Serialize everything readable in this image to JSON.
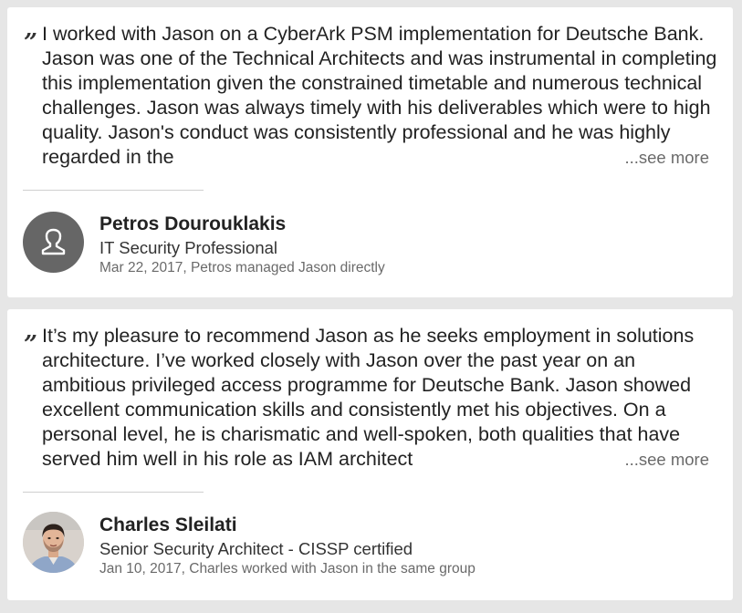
{
  "recommendations": [
    {
      "quote": "I worked with Jason on a CyberArk PSM implementation for Deutsche Bank. Jason was one of the Technical Architects and was instrumental in completing this implementation given the constrained timetable and numerous technical challenges. Jason was always timely with his deliverables which were to high quality. Jason's conduct was consistently professional and he was highly regarded in the",
      "see_more": "...see more",
      "name": "Petros Dourouklakis",
      "title": "IT Security Professional",
      "meta": "Mar 22, 2017, Petros managed Jason directly",
      "avatar_icon": "default-person-icon"
    },
    {
      "quote": "It’s my pleasure to recommend Jason as he seeks employment in solutions architecture. I’ve worked closely with Jason over the past year on an ambitious privileged access programme for Deutsche Bank. Jason showed excellent communication skills and consistently met his objectives. On a personal level, he is charismatic and well-spoken, both qualities that have served him well in his role as IAM architect",
      "see_more": "...see more",
      "name": "Charles Sleilati",
      "title": "Senior Security Architect - CISSP certified",
      "meta": "Jan 10, 2017, Charles worked with Jason in the same group",
      "avatar_icon": "profile-photo"
    }
  ],
  "quote_glyph": "”",
  "colors": {
    "background": "#e6e6e6",
    "card": "#ffffff",
    "text": "#222222",
    "muted": "#6a6a6a",
    "default_avatar": "#666666"
  }
}
